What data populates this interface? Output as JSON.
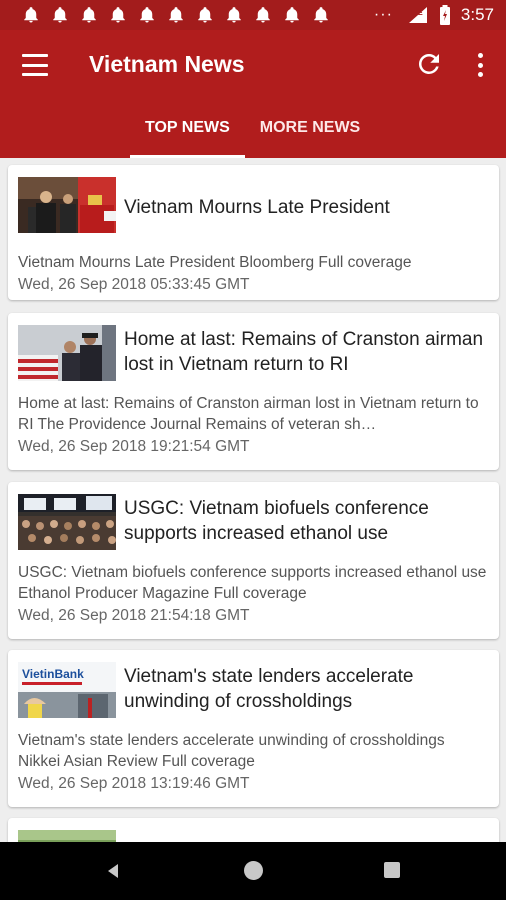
{
  "status_bar": {
    "time": "3:57",
    "network": "LTE",
    "notification_count": 11,
    "overflow": "···"
  },
  "app_bar": {
    "title": "Vietnam News",
    "background_color": "#b11d1d",
    "status_color": "#a31c1c"
  },
  "tabs": [
    {
      "label": "TOP NEWS",
      "active": true
    },
    {
      "label": "MORE NEWS",
      "active": false
    }
  ],
  "articles": [
    {
      "title": "Vietnam Mourns Late President",
      "summary": "Vietnam Mourns Late President  Bloomberg  Full coverage",
      "date": "Wed, 26 Sep 2018 05:33:45 GMT"
    },
    {
      "title": "Home at last: Remains of Cranston airman lost in Vietnam return to RI",
      "summary": "Home at last: Remains of Cranston airman lost in Vietnam return to RI  The Providence Journal  Remains of veteran sh…",
      "date": "Wed, 26 Sep 2018 19:21:54 GMT"
    },
    {
      "title": "USGC: Vietnam biofuels conference supports increased ethanol use",
      "summary": "USGC: Vietnam biofuels conference supports increased ethanol use  Ethanol Producer Magazine  Full coverage",
      "date": "Wed, 26 Sep 2018 21:54:18 GMT"
    },
    {
      "title": "Vietnam's state lenders accelerate unwinding of crossholdings",
      "summary": "Vietnam's state lenders accelerate unwinding of crossholdings  Nikkei Asian Review  Full coverage",
      "date": "Wed, 26 Sep 2018 13:19:46 GMT"
    }
  ],
  "thumbnails": {
    "article_4_logo_text": "VietinBank"
  },
  "icons": {
    "menu": "menu-icon",
    "refresh": "refresh-icon",
    "more": "more-vert-icon",
    "notification": "bell-icon",
    "back": "back-icon",
    "home": "home-icon",
    "recents": "recents-icon"
  }
}
